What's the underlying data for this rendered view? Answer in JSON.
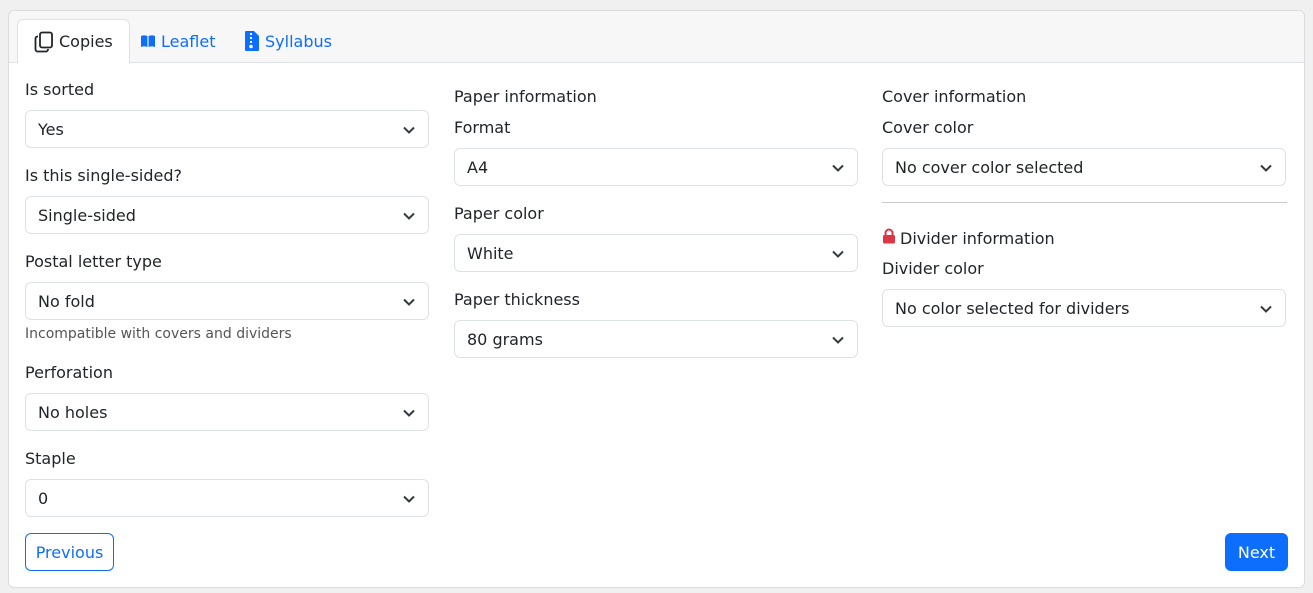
{
  "tabs": [
    {
      "label": "Copies",
      "icon": "copy-icon",
      "active": true
    },
    {
      "label": "Leaflet",
      "icon": "book-icon",
      "active": false
    },
    {
      "label": "Syllabus",
      "icon": "zip-file-icon",
      "active": false
    }
  ],
  "left": {
    "sorted": {
      "label": "Is sorted",
      "value": "Yes"
    },
    "sided": {
      "label": "Is this single-sided?",
      "value": "Single-sided"
    },
    "postal": {
      "label": "Postal letter type",
      "value": "No fold",
      "hint": "Incompatible with covers and dividers"
    },
    "perforation": {
      "label": "Perforation",
      "value": "No holes"
    },
    "staple": {
      "label": "Staple",
      "value": "0"
    }
  },
  "middle": {
    "heading": "Paper information",
    "format": {
      "label": "Format",
      "value": "A4"
    },
    "color": {
      "label": "Paper color",
      "value": "White"
    },
    "thickness": {
      "label": "Paper thickness",
      "value": "80 grams"
    }
  },
  "right": {
    "cover_heading": "Cover information",
    "cover_color": {
      "label": "Cover color",
      "value": "No cover color selected"
    },
    "divider_heading": "Divider information",
    "divider_color": {
      "label": "Divider color",
      "value": "No color selected for dividers"
    }
  },
  "buttons": {
    "previous": "Previous",
    "next": "Next"
  },
  "colors": {
    "accent": "#0d6efd",
    "lock": "#dc3545"
  }
}
